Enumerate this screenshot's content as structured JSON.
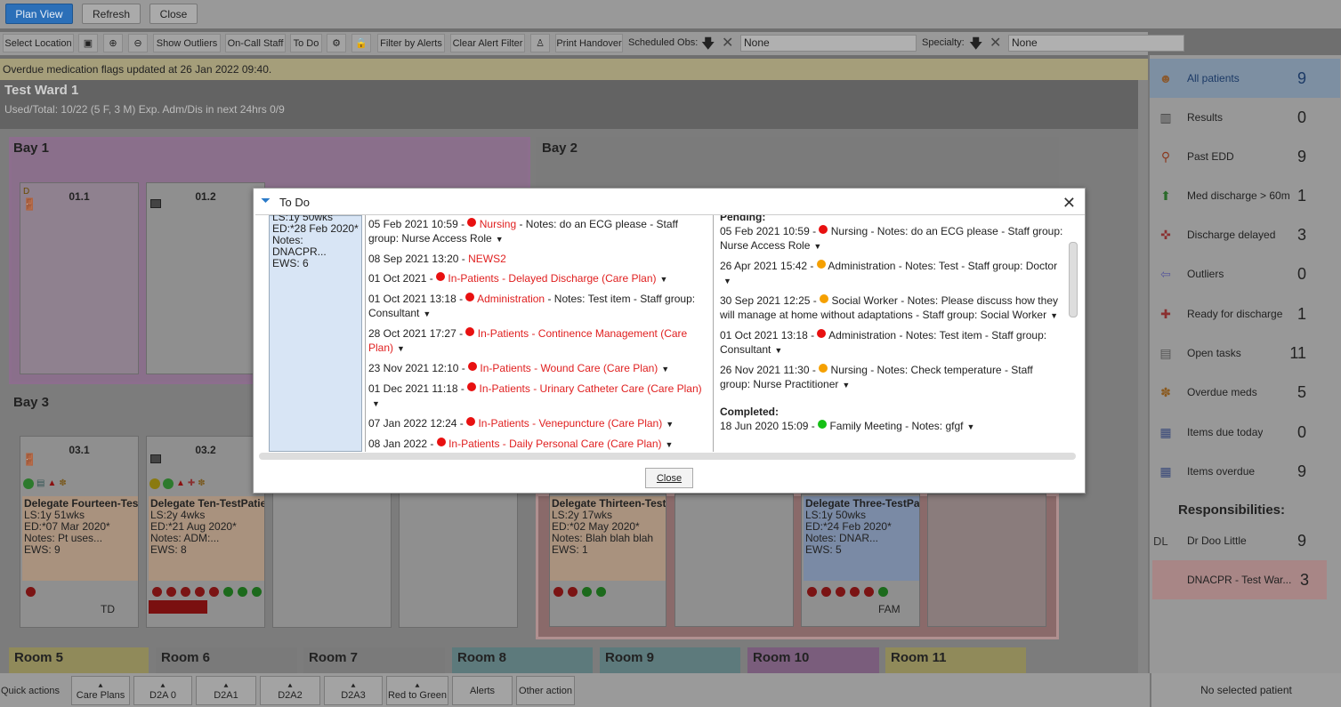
{
  "top": {
    "plan_view": "Plan View",
    "refresh": "Refresh",
    "close": "Close"
  },
  "toolbar": {
    "select_location": "Select Location",
    "show_outliers": "Show Outliers",
    "on_call_staff": "On-Call Staff",
    "to_do": "To Do",
    "filter_by_alerts": "Filter by Alerts",
    "clear_alert_filter": "Clear Alert Filter",
    "print_handover": "Print Handover",
    "scheduled_obs_label": "Scheduled Obs:",
    "scheduled_obs_value": "None",
    "specialty_label": "Specialty:",
    "specialty_value": "None"
  },
  "alert_message": "Overdue medication flags updated at 26 Jan 2022 09:40.",
  "ward": {
    "title": "Test Ward 1",
    "summary": "Used/Total: 10/22 (5 F, 3 M) Exp. Adm/Dis in next 24hrs 0/9"
  },
  "bays": {
    "bay1": "Bay 1",
    "bay2": "Bay 2",
    "bay3": "Bay 3"
  },
  "beds": {
    "b011": "01.1",
    "b012": "01.2",
    "b031": "03.1",
    "b032": "03.2",
    "b011_flag": "D"
  },
  "patients": [
    {
      "name": "Delegate Fourteen-Test",
      "ls": "LS:1y 51wks",
      "ed": "ED:*07 Mar 2020*",
      "notes": "Notes: Pt uses...",
      "ews": "EWS: 9",
      "tag": "TD"
    },
    {
      "name": "Delegate Ten-TestPatie",
      "ls": "LS:2y 4wks",
      "ed": "ED:*21 Aug 2020*",
      "notes": "Notes: ADM:...",
      "ews": "EWS: 8",
      "tag": ""
    },
    {
      "name": "Delegate Thirteen-Testl",
      "ls": "LS:2y 17wks",
      "ed": "ED:*02 May 2020*",
      "notes": "Notes: Blah blah blah",
      "ews": "EWS: 1",
      "tag": ""
    },
    {
      "name": "Delegate Three-TestPa",
      "ls": "LS:1y 50wks",
      "ed": "ED:*24 Feb 2020*",
      "notes": "Notes: DNAR...",
      "ews": "EWS: 5",
      "tag": "FAM"
    }
  ],
  "rooms": [
    "Room 5",
    "Room 6",
    "Room 7",
    "Room 8",
    "Room 9",
    "Room 10",
    "Room 11"
  ],
  "sidebar": {
    "items": [
      {
        "label": "All patients",
        "count": "9",
        "icon": "all-patients-icon"
      },
      {
        "label": "Results",
        "count": "0",
        "icon": "results-icon"
      },
      {
        "label": "Past EDD",
        "count": "9",
        "icon": "past-edd-icon"
      },
      {
        "label": "Med discharge > 60m",
        "count": "1",
        "icon": "med-discharge-icon"
      },
      {
        "label": "Discharge delayed",
        "count": "3",
        "icon": "discharge-delayed-icon"
      },
      {
        "label": "Outliers",
        "count": "0",
        "icon": "outliers-icon"
      },
      {
        "label": "Ready for discharge",
        "count": "1",
        "icon": "ready-discharge-icon"
      },
      {
        "label": "Open tasks",
        "count": "11",
        "icon": "open-tasks-icon"
      },
      {
        "label": "Overdue meds",
        "count": "5",
        "icon": "overdue-meds-icon"
      },
      {
        "label": "Items due today",
        "count": "0",
        "icon": "items-due-icon"
      },
      {
        "label": "Items overdue",
        "count": "9",
        "icon": "items-overdue-icon"
      }
    ],
    "responsibilities_title": "Responsibilities:",
    "resp": [
      {
        "prefix": "DL",
        "label": "Dr Doo Little",
        "count": "9"
      },
      {
        "prefix": "",
        "label": "DNACPR - Test War...",
        "count": "3"
      }
    ]
  },
  "bottom": {
    "quick_actions": "Quick actions",
    "buttons": [
      "Care Plans",
      "D2A 0",
      "D2A1",
      "D2A2",
      "D2A3",
      "Red to Green",
      "Alerts",
      "Other action"
    ],
    "no_selected": "No selected patient"
  },
  "dialog": {
    "title": "To Do",
    "close_button": "Close",
    "left": {
      "l1": "LS:1y 50wks",
      "l2": "ED:*28 Feb 2020*",
      "l3": "Notes: DNACPR...",
      "l4": "EWS: 6"
    },
    "mid": [
      {
        "date": "05 Feb 2021 10:59 - ",
        "cat": "Nursing",
        "rest": " - Notes: do an ECG please - Staff group: Nurse Access Role"
      },
      {
        "date": "08 Sep 2021 13:20 - ",
        "cat": "NEWS2",
        "rest": ""
      },
      {
        "date": "01 Oct 2021 - ",
        "cat": "In-Patients - Delayed Discharge (Care Plan)",
        "rest": ""
      },
      {
        "date": "01 Oct 2021 13:18 - ",
        "cat": "Administration",
        "rest": " - Notes: Test item - Staff group: Consultant"
      },
      {
        "date": "28 Oct 2021 17:27 - ",
        "cat": "In-Patients - Continence Management (Care Plan)",
        "rest": ""
      },
      {
        "date": "23 Nov 2021 12:10 - ",
        "cat": "In-Patients - Wound Care (Care Plan)",
        "rest": ""
      },
      {
        "date": "01 Dec 2021 11:18 - ",
        "cat": "In-Patients - Urinary Catheter Care (Care Plan)",
        "rest": ""
      },
      {
        "date": "07 Jan 2022 12:24 - ",
        "cat": "In-Patients - Venepuncture (Care Plan)",
        "rest": ""
      },
      {
        "date": "08 Jan 2022 - ",
        "cat": "In-Patients - Daily Personal Care (Care Plan)",
        "rest": ""
      }
    ],
    "pending_label": "Pending:",
    "right": [
      {
        "text": "05 Feb 2021 10:59 - ",
        "after": "Nursing - Notes: do an ECG please - Staff group: Nurse Access Role",
        "dot": "red"
      },
      {
        "text": "26 Apr 2021 15:42 - ",
        "after": "Administration - Notes: Test - Staff group: Doctor",
        "dot": "orange"
      },
      {
        "text": "30 Sep 2021 12:25 - ",
        "after": "Social Worker - Notes: Please discuss how they will manage at home without adaptations - Staff group: Social Worker",
        "dot": "orange"
      },
      {
        "text": "01 Oct 2021 13:18 - ",
        "after": "Administration - Notes: Test item - Staff group: Consultant",
        "dot": "red"
      },
      {
        "text": "26 Nov 2021 11:30 - ",
        "after": "Nursing - Notes: Check temperature - Staff group: Nurse Practitioner",
        "dot": "orange"
      }
    ],
    "completed_label": "Completed:",
    "completed": {
      "text": "18 Jun 2020 15:09 - ",
      "after": "Family Meeting - Notes: gfgf"
    }
  }
}
